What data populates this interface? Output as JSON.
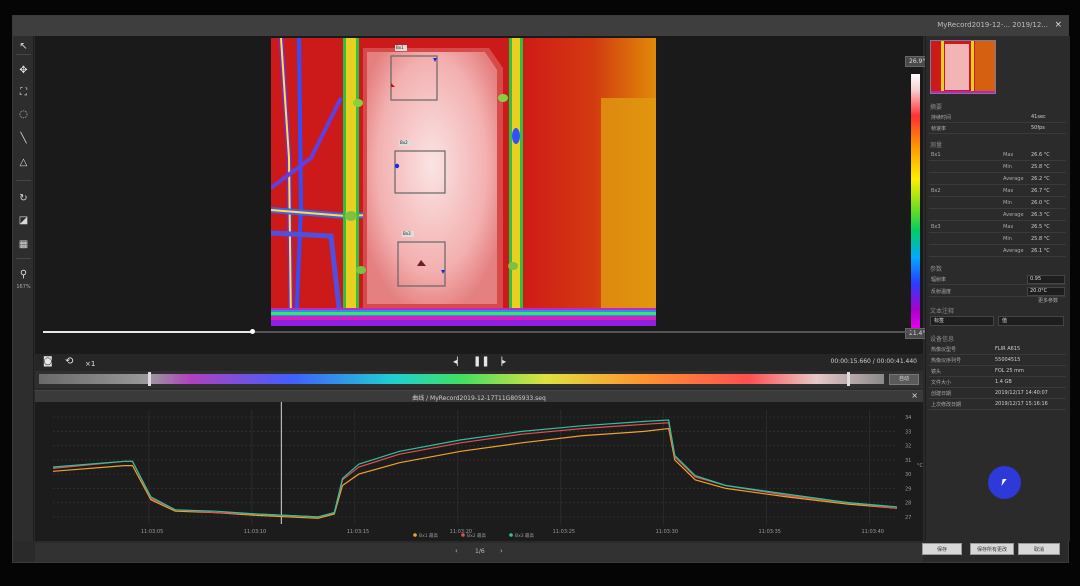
{
  "window": {
    "title": "MyRecord2019-12-... 2019/12...",
    "close_glyph": "×"
  },
  "toolbar": {
    "tools": [
      {
        "name": "select-arrow-icon",
        "glyph": "↖"
      },
      {
        "name": "point-spot-icon",
        "glyph": "✥"
      },
      {
        "name": "box-area-icon",
        "glyph": "⛶"
      },
      {
        "name": "ellipse-area-icon",
        "glyph": "◌"
      },
      {
        "name": "line-icon",
        "glyph": "╲"
      },
      {
        "name": "polygon-icon",
        "glyph": "△"
      },
      {
        "name": "rotate-icon",
        "glyph": "↻"
      },
      {
        "name": "palette-fill-icon",
        "glyph": "◪"
      },
      {
        "name": "color-palette-icon",
        "glyph": "▦"
      },
      {
        "name": "zoom-icon",
        "glyph": "⚲"
      }
    ],
    "zoom_label": "167%"
  },
  "thermal": {
    "max_temp_label": "26.9°C",
    "min_temp_label": "21.4°C",
    "boxes": [
      {
        "label": "Bx1"
      },
      {
        "label": "Bx2"
      },
      {
        "label": "Bx3"
      }
    ]
  },
  "playback": {
    "progress": 0.24,
    "speed_label": "×1",
    "time_readout": "00:00:15.660 / 00:00:41.440"
  },
  "palette": {
    "button_label": "自动"
  },
  "chart_panel": {
    "title": "曲线 / MyRecord2019-12-17T11G805933.seq"
  },
  "pager": {
    "prev": "‹",
    "page": "1/6",
    "next": "›"
  },
  "right_panel": {
    "info_title": "摘要",
    "info_rows": [
      {
        "key": "持续时间",
        "value": "41sec"
      },
      {
        "key": "帧速率",
        "value": "50fps"
      }
    ],
    "measure_title": "测量",
    "measurements": [
      {
        "box": "Bx1",
        "rows": [
          {
            "stat": "Max",
            "value": "26.6 °C"
          },
          {
            "stat": "Min",
            "value": "25.8 °C"
          },
          {
            "stat": "Average",
            "value": "26.2 °C"
          }
        ]
      },
      {
        "box": "Bx2",
        "rows": [
          {
            "stat": "Max",
            "value": "26.7 °C"
          },
          {
            "stat": "Min",
            "value": "26.0 °C"
          },
          {
            "stat": "Average",
            "value": "26.3 °C"
          }
        ]
      },
      {
        "box": "Bx3",
        "rows": [
          {
            "stat": "Max",
            "value": "26.5 °C"
          },
          {
            "stat": "Min",
            "value": "25.8 °C"
          },
          {
            "stat": "Average",
            "value": "26.1 °C"
          }
        ]
      }
    ],
    "params_title": "参数",
    "params": [
      {
        "key": "辐射率",
        "value": "0.95"
      },
      {
        "key": "反射温度",
        "value": "20.0°C"
      }
    ],
    "params_link": "更多参数",
    "text_title": "文本注释",
    "text_left": "标签",
    "text_right": "值",
    "device_title": "设备信息",
    "device_rows": [
      {
        "key": "热像仪型号",
        "value": "FLIR A615"
      },
      {
        "key": "热像仪序列号",
        "value": "55004515"
      },
      {
        "key": "镜头",
        "value": "FOL 25 mm"
      },
      {
        "key": "文件大小",
        "value": "1.4 GB"
      },
      {
        "key": "创建日期",
        "value": "2019/12/17 14:40:07"
      },
      {
        "key": "上次修改日期",
        "value": "2019/12/17 15:16:16"
      }
    ]
  },
  "bottom_buttons": [
    {
      "name": "ok-button",
      "label": "保存"
    },
    {
      "name": "save-as-button",
      "label": "保存所有更改"
    },
    {
      "name": "cancel-button",
      "label": "取消"
    }
  ],
  "chart_data": {
    "type": "line",
    "title": "",
    "xlabel": "",
    "ylabel": "",
    "x_ticks": [
      "11:03:05",
      "11:03:10",
      "11:03:15",
      "11:03:20",
      "11:03:25",
      "11:03:30",
      "11:03:35",
      "11:03:40",
      "11:03:45"
    ],
    "y_ticks": [
      27,
      28,
      29,
      30,
      31,
      32,
      33,
      34
    ],
    "y_unit": "°C",
    "ylim": [
      26.5,
      34.5
    ],
    "xlim": [
      0,
      41.4
    ],
    "cursor_x": 11.2,
    "legend": [
      "Bx1 最高",
      "Bx2 最高",
      "Bx3 最高"
    ],
    "series": [
      {
        "name": "Bx1 最高",
        "color": "#f0a030",
        "points": [
          [
            0,
            30.2
          ],
          [
            3.5,
            30.6
          ],
          [
            3.9,
            30.6
          ],
          [
            4.8,
            28.2
          ],
          [
            6,
            27.4
          ],
          [
            8,
            27.3
          ],
          [
            10,
            27.1
          ],
          [
            13,
            26.9
          ],
          [
            13.8,
            27.2
          ],
          [
            14.2,
            29.2
          ],
          [
            15,
            30.0
          ],
          [
            17,
            30.8
          ],
          [
            20,
            31.6
          ],
          [
            23,
            32.2
          ],
          [
            26,
            32.7
          ],
          [
            29,
            33.0
          ],
          [
            30.2,
            33.2
          ],
          [
            30.5,
            31.0
          ],
          [
            31.5,
            29.6
          ],
          [
            33,
            29.0
          ],
          [
            36,
            28.4
          ],
          [
            39,
            27.9
          ],
          [
            41.4,
            27.6
          ]
        ]
      },
      {
        "name": "Bx2 最高",
        "color": "#e05050",
        "points": [
          [
            0,
            30.4
          ],
          [
            3.5,
            30.9
          ],
          [
            3.9,
            30.9
          ],
          [
            4.8,
            28.3
          ],
          [
            6,
            27.5
          ],
          [
            8,
            27.3
          ],
          [
            10,
            27.2
          ],
          [
            13,
            27.0
          ],
          [
            13.8,
            27.3
          ],
          [
            14.2,
            29.6
          ],
          [
            15,
            30.5
          ],
          [
            17,
            31.4
          ],
          [
            20,
            32.2
          ],
          [
            23,
            32.8
          ],
          [
            26,
            33.2
          ],
          [
            29,
            33.5
          ],
          [
            30.2,
            33.6
          ],
          [
            30.5,
            31.2
          ],
          [
            31.5,
            29.8
          ],
          [
            33,
            29.2
          ],
          [
            36,
            28.5
          ],
          [
            39,
            28.0
          ],
          [
            41.4,
            27.6
          ]
        ]
      },
      {
        "name": "Bx3 最高",
        "color": "#30c0a0",
        "points": [
          [
            0,
            30.5
          ],
          [
            3.5,
            30.9
          ],
          [
            3.9,
            30.9
          ],
          [
            4.8,
            28.4
          ],
          [
            6,
            27.5
          ],
          [
            8,
            27.4
          ],
          [
            10,
            27.2
          ],
          [
            13,
            27.0
          ],
          [
            13.8,
            27.3
          ],
          [
            14.2,
            29.7
          ],
          [
            15,
            30.7
          ],
          [
            17,
            31.6
          ],
          [
            20,
            32.4
          ],
          [
            23,
            33.0
          ],
          [
            26,
            33.4
          ],
          [
            29,
            33.7
          ],
          [
            30.2,
            33.8
          ],
          [
            30.5,
            31.3
          ],
          [
            31.5,
            29.9
          ],
          [
            33,
            29.2
          ],
          [
            36,
            28.6
          ],
          [
            39,
            28.0
          ],
          [
            41.4,
            27.7
          ]
        ]
      }
    ]
  }
}
